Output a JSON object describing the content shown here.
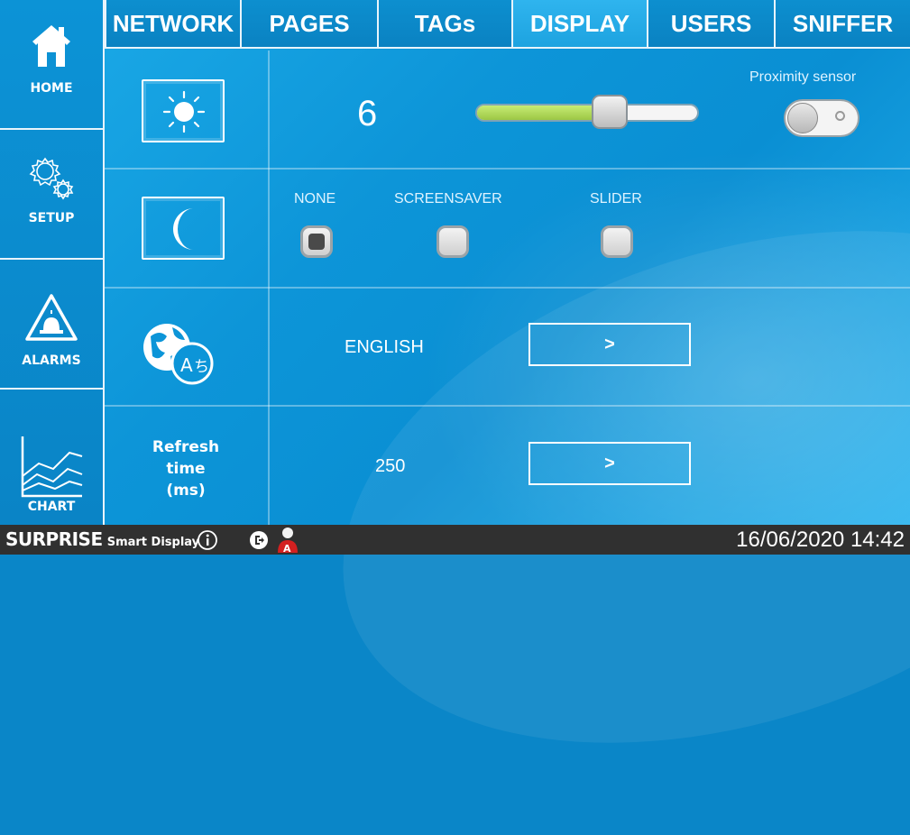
{
  "sidebar": {
    "items": [
      {
        "label": "HOME",
        "icon": "home-icon"
      },
      {
        "label": "SETUP",
        "icon": "gears-icon"
      },
      {
        "label": "ALARMS",
        "icon": "alarm-icon"
      },
      {
        "label": "CHART",
        "icon": "chart-icon"
      }
    ]
  },
  "tabs": [
    {
      "label": "NETWORK",
      "active": false
    },
    {
      "label": "PAGES",
      "active": false
    },
    {
      "label": "TAGs",
      "active": false
    },
    {
      "label": "DISPLAY",
      "active": true
    },
    {
      "label": "USERS",
      "active": false
    },
    {
      "label": "SNIFFER",
      "active": false
    }
  ],
  "display": {
    "brightness": {
      "icon": "brightness-icon",
      "value": "6",
      "slider_fraction": 0.6,
      "proximity_label": "Proximity sensor",
      "proximity_on": false
    },
    "screensaver": {
      "icon": "moon-icon",
      "options": [
        {
          "label": "NONE",
          "checked": true
        },
        {
          "label": "SCREENSAVER",
          "checked": false
        },
        {
          "label": "SLIDER",
          "checked": false
        }
      ]
    },
    "language": {
      "icon": "language-icon",
      "value": "ENGLISH",
      "button_label": ">"
    },
    "refresh": {
      "label_line1": "Refresh",
      "label_line2": "time",
      "label_line3": "(ms)",
      "value": "250",
      "button_label": ">"
    }
  },
  "statusbar": {
    "brand": "SURPRISE",
    "brand_sub": "Smart Display",
    "info_icon": "info-icon",
    "logout_icon": "logout-icon",
    "user_icon": "admin-user-icon",
    "user_badge": "A",
    "datetime": "16/06/2020 14:42"
  },
  "colors": {
    "accent_blue": "#1aa8e6",
    "sidebar_blue": "#0c93d6",
    "statusbar": "#303030",
    "slider_fill": "#b5dc5c"
  }
}
